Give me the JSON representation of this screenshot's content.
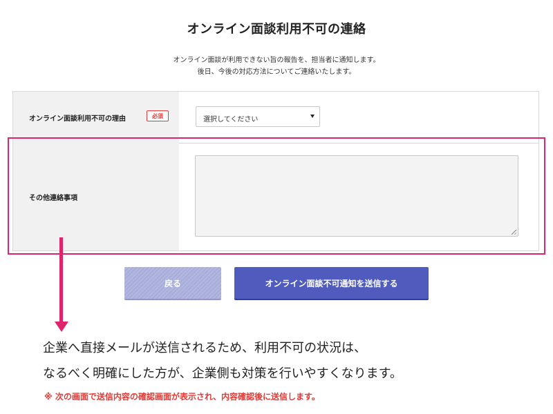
{
  "header": {
    "title": "オンライン面談利用不可の連絡",
    "description_lines": [
      "オンライン面談が利用できない旨の報告を、担当者に通知します。",
      "後日、今後の対応方法についてご連絡いたします。"
    ]
  },
  "form": {
    "reason": {
      "label": "オンライン面談利用不可の理由",
      "required_badge": "必須",
      "select_value": "選択してください"
    },
    "other": {
      "label": "その他連絡事項",
      "textarea_value": ""
    }
  },
  "buttons": {
    "back_label": "戻る",
    "send_label": "オンライン面談不可通知を送信する"
  },
  "annotation": {
    "lines": [
      "企業へ直接メールが送信されるため、利用不可の状況は、",
      "なるべく明確にした方が、企業側も対策を行いやすくなります。"
    ],
    "note": "※ 次の画面で送信内容の確認画面が表示され、内容確認後に送信します。"
  },
  "colors": {
    "highlight": "#e0246a",
    "primary_button": "#4f5bbd",
    "disabled_button": "#aab0dc",
    "required": "#e53935"
  },
  "icons": {
    "select_chevron": "chevron-down-icon",
    "arrow": "arrow-down-icon"
  }
}
